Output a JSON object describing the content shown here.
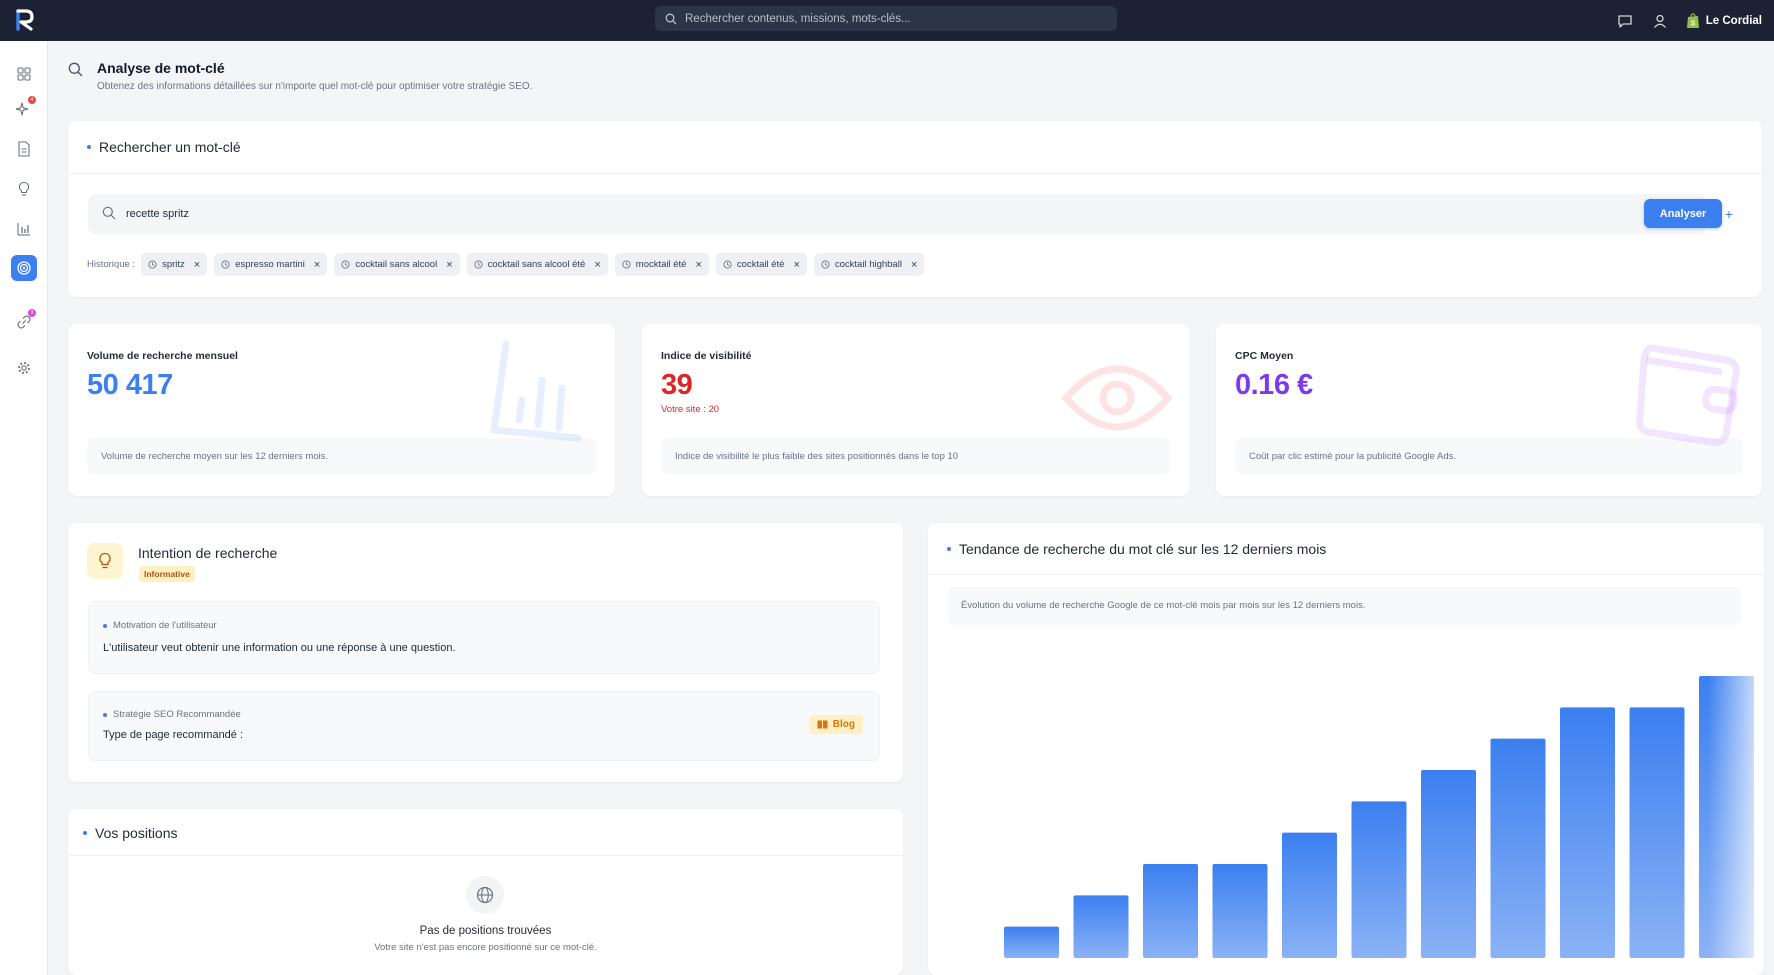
{
  "topbar": {
    "search_placeholder": "Rechercher contenus, missions, mots-clés...",
    "user_name": "Le Cordial"
  },
  "sidebar": {
    "items": [
      {
        "icon": "dashboard-icon",
        "active": false,
        "badge": ""
      },
      {
        "icon": "sparkles-icon",
        "active": false,
        "badge": "4"
      },
      {
        "icon": "document-icon",
        "active": false,
        "badge": ""
      },
      {
        "icon": "lightbulb-icon",
        "active": false,
        "badge": ""
      },
      {
        "icon": "bar-chart-icon",
        "active": false,
        "badge": ""
      },
      {
        "icon": "target-icon",
        "active": true,
        "badge": ""
      },
      {
        "icon": "link-icon",
        "active": false,
        "badge": "3"
      },
      {
        "icon": "gear-icon",
        "active": false,
        "badge": ""
      }
    ]
  },
  "header": {
    "title": "Analyse de mot-clé",
    "subtitle": "Obtenez des informations détaillées sur n'importe quel mot-clé pour optimiser votre stratégie SEO."
  },
  "search_card": {
    "title": "Rechercher un mot-clé",
    "input_value": "recette spritz",
    "analyse_label": "Analyser",
    "plus_label": "+",
    "history_label": "Historique :",
    "history": [
      "spritz",
      "espresso martini",
      "cocktail sans alcool",
      "cocktail sans alcool été",
      "mocktail été",
      "cocktail été",
      "cocktail highball"
    ]
  },
  "stats": {
    "volume": {
      "label": "Volume de recherche mensuel",
      "value": "50 417",
      "note": "Volume de recherche moyen sur les 12 derniers mois.",
      "color": "#3b7ff0"
    },
    "visibility": {
      "label": "Indice de visibilité",
      "value": "39",
      "sub": "Votre site : 20",
      "note": "Indice de visibilité le plus faible des sites positionnés dans le top 10",
      "color": "#dc2626"
    },
    "cpc": {
      "label": "CPC Moyen",
      "value": "0.16 €",
      "note": "Coût par clic estimé pour la publicité Google Ads.",
      "color": "#7c3aed"
    }
  },
  "intent": {
    "title": "Intention de recherche",
    "badge": "Informative",
    "motivation_label": "Motivation de l'utilisateur",
    "motivation_text": "L'utilisateur veut obtenir une information ou une réponse à une question.",
    "strategy_label": "Stratégie SEO Recommandée",
    "strategy_text": "Type de page recommandé :",
    "page_type": "Blog"
  },
  "positions": {
    "title": "Vos positions",
    "empty_title": "Pas de positions trouvées",
    "empty_sub": "Votre site n'est pas encore positionné sur ce mot-clé."
  },
  "trend": {
    "title": "Tendance de recherche du mot clé sur les 12 derniers mois",
    "note": "Évolution du volume de recherche Google de ce mot-clé mois par mois sur les 12 derniers mois."
  },
  "chart_data": {
    "type": "bar",
    "title": "",
    "xlabel": "",
    "ylabel": "",
    "values": [
      1,
      2,
      3,
      3,
      4,
      5,
      6,
      7,
      8,
      8,
      9
    ],
    "ylim": [
      0,
      9
    ],
    "grid": false,
    "colors": {
      "top": "#3b7ff0",
      "bottom": "#8bb2f5"
    }
  }
}
